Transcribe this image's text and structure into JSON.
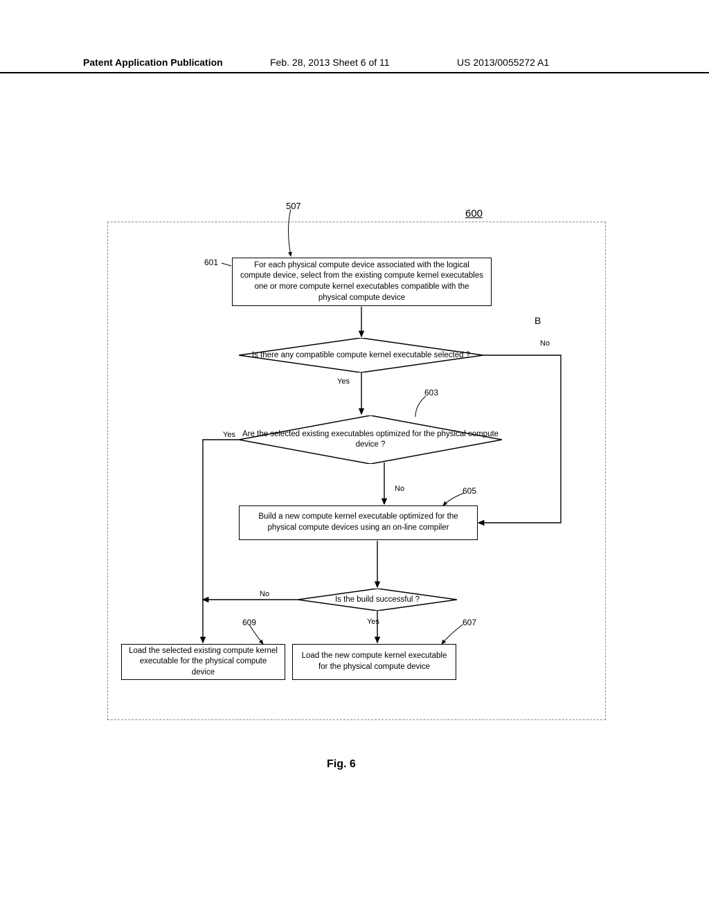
{
  "header": {
    "left": "Patent Application Publication",
    "mid": "Feb. 28, 2013  Sheet 6 of 11",
    "right": "US 2013/0055272 A1"
  },
  "refs": {
    "r507": "507",
    "r600": "600",
    "r601": "601",
    "r603": "603",
    "r605": "605",
    "r607": "607",
    "r609": "609",
    "B": "B",
    "no": "No",
    "yes": "Yes"
  },
  "boxes": {
    "b601": "For each physical compute device associated with the logical compute device, select from the existing compute kernel executables one or more compute kernel executables compatible with the physical compute device",
    "d1": "Is there any compatible compute kernel executable selected ?",
    "d2": "Are the selected existing executables optimized for the  physical compute device ?",
    "b605": "Build a new compute kernel executable optimized for the physical compute devices using an on-line compiler",
    "d3": "Is the build successful ?",
    "b607": "Load the new compute kernel executable for the physical compute device",
    "b609": "Load the selected existing compute kernel executable for the physical compute device"
  },
  "figure_label": "Fig. 6"
}
